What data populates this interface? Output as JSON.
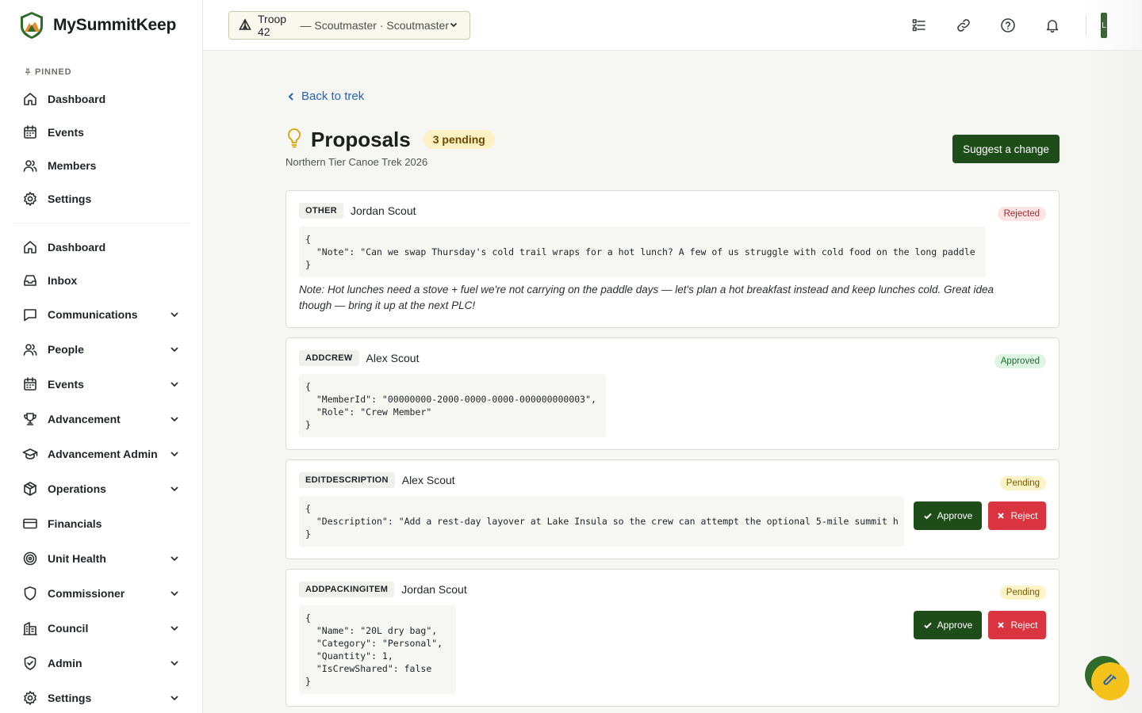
{
  "brand": {
    "name": "MySummitKeep"
  },
  "sidebar": {
    "pinned_label": "PINNED",
    "pinned": [
      {
        "label": "Dashboard",
        "icon": "home-icon"
      },
      {
        "label": "Events",
        "icon": "calendar-icon"
      },
      {
        "label": "Members",
        "icon": "users-icon"
      },
      {
        "label": "Settings",
        "icon": "gear-icon"
      }
    ],
    "items": [
      {
        "label": "Dashboard",
        "icon": "home-icon",
        "expandable": false
      },
      {
        "label": "Inbox",
        "icon": "inbox-icon",
        "expandable": false
      },
      {
        "label": "Communications",
        "icon": "chat-icon",
        "expandable": true
      },
      {
        "label": "People",
        "icon": "users-icon",
        "expandable": true
      },
      {
        "label": "Events",
        "icon": "calendar-icon",
        "expandable": true
      },
      {
        "label": "Advancement",
        "icon": "trophy-icon",
        "expandable": true
      },
      {
        "label": "Advancement Admin",
        "icon": "graduation-cap-icon",
        "expandable": true
      },
      {
        "label": "Operations",
        "icon": "box-icon",
        "expandable": true
      },
      {
        "label": "Financials",
        "icon": "credit-card-icon",
        "expandable": false
      },
      {
        "label": "Unit Health",
        "icon": "target-icon",
        "expandable": true
      },
      {
        "label": "Commissioner",
        "icon": "shield-icon",
        "expandable": true
      },
      {
        "label": "Council",
        "icon": "building-icon",
        "expandable": true
      },
      {
        "label": "Admin",
        "icon": "shield-check-icon",
        "expandable": true
      },
      {
        "label": "Settings",
        "icon": "gear-icon",
        "expandable": true
      }
    ]
  },
  "header": {
    "unit_troop": "Troop 42",
    "unit_role": " — Scoutmaster · Scoutmaster",
    "avatar_initial": "L"
  },
  "page": {
    "back_label": "Back to trek",
    "title": "Proposals",
    "pending_badge": "3 pending",
    "subtitle": "Northern Tier Canoe Trek 2026",
    "suggest_label": "Suggest a change"
  },
  "proposals": [
    {
      "type": "OTHER",
      "author": "Jordan Scout",
      "status": "Rejected",
      "payload": "{\n  \"Note\": \"Can we swap Thursday's cold trail wraps for a hot lunch? A few of us struggle with cold food on the long paddle\n}",
      "note": "Note: Hot lunches need a stove + fuel we're not carrying on the paddle days — let's plan a hot breakfast instead and keep lunches cold. Great idea though — bring it up at the next PLC!"
    },
    {
      "type": "ADDCREW",
      "author": "Alex Scout",
      "status": "Approved",
      "payload": "{\n  \"MemberId\": \"00000000-2000-0000-0000-000000000003\",\n  \"Role\": \"Crew Member\"\n}"
    },
    {
      "type": "EDITDESCRIPTION",
      "author": "Alex Scout",
      "status": "Pending",
      "payload": "{\n  \"Description\": \"Add a rest-day layover at Lake Insula so the crew can attempt the optional 5-mile summit h\n}",
      "approve_label": "Approve",
      "reject_label": "Reject"
    },
    {
      "type": "ADDPACKINGITEM",
      "author": "Jordan Scout",
      "status": "Pending",
      "payload": "{\n  \"Name\": \"20L dry bag\",\n  \"Category\": \"Personal\",\n  \"Quantity\": 1,\n  \"IsCrewShared\": false\n}",
      "approve_label": "Approve",
      "reject_label": "Reject"
    }
  ],
  "colors": {
    "brand_green": "#1f4d1a",
    "reject_red": "#d9343f",
    "link_blue": "#2563b8",
    "pending_yellow": "#fbf1c2",
    "fab_yellow": "#f5c21b"
  }
}
